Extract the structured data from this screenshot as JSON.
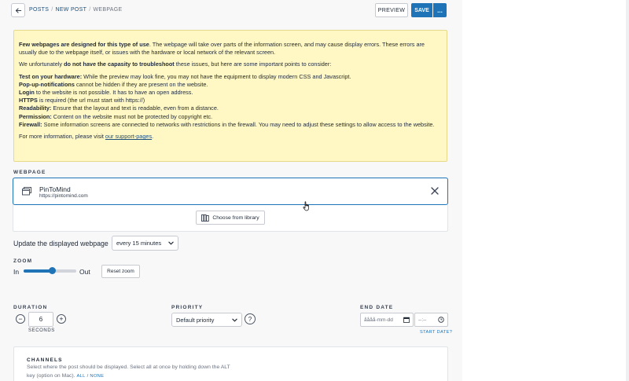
{
  "colors": {
    "accent": "#1f73b7",
    "notice_bg": "#fff8c5",
    "notice_border": "#e6da8a",
    "link": "#1f4e79"
  },
  "header": {
    "back_icon": "arrow-left-icon",
    "breadcrumb": {
      "item1": "POSTS",
      "sep1": "/",
      "item2": "NEW POST",
      "sep2": "/",
      "current": "WEBPAGE"
    },
    "preview_label": "PREVIEW",
    "save_label": "SAVE",
    "more_label": "..."
  },
  "notice": {
    "line1_bold": "Few webpages are designed for this type of use",
    "line1_rest": ". The webpage will take over parts of the information screen, and may cause display errors. These errors are usually due to the webpage itself, or issues with the hardware or local network of the relevant screen.",
    "line2_pre": "We unfortunately ",
    "line2_bold": "do not have the capasity to troubleshoot",
    "line2_post": " these issues, but here are some important points to consider:",
    "items": [
      {
        "bold": "Test on your hardware:",
        "text": " While the preview may look fine, you may not have the equipment to display modern CSS and Javascript."
      },
      {
        "bold": "Pop-up-notifications",
        "text": " cannot be hidden if they are present on the website."
      },
      {
        "bold": "Login",
        "text": " to the website is not possible. It has to have an open address."
      },
      {
        "bold": "HTTPS",
        "text": " is required (the url must start with https://)"
      },
      {
        "bold": "Readability:",
        "text": " Ensure that the layout and text is readable, even from a distance."
      },
      {
        "bold": "Permission:",
        "text": " Content on the website must not be protected by copyright etc."
      },
      {
        "bold": "Firewall:",
        "text": " Some information screens are connected to networks with restrictions in the firewall. You may need to adjust these settings to allow access to the website."
      }
    ],
    "more_info_pre": "For more information, please visit ",
    "more_info_link": "our support-pages",
    "more_info_post": "."
  },
  "webpage": {
    "section_label": "WEBPAGE",
    "name": "PinToMind",
    "url": "https://pintomind.com",
    "icon": "browser-window-icon",
    "close_icon": "close-icon",
    "library_icon": "library-icon",
    "library_label": "Choose from library"
  },
  "update": {
    "label": "Update the displayed webpage",
    "selected": "every 15 minutes"
  },
  "zoom": {
    "section_label": "ZOOM",
    "in_label": "In",
    "out_label": "Out",
    "level_fraction": 0.55,
    "reset_label": "Reset zoom"
  },
  "duration": {
    "section_label": "DURATION",
    "value": "6",
    "minus_label": "−",
    "plus_label": "+",
    "unit_label": "SECONDS"
  },
  "priority": {
    "section_label": "PRIORITY",
    "selected": "Default priority",
    "help_label": "?"
  },
  "end_date": {
    "section_label": "END DATE",
    "date_placeholder": "åååå-mm-dd",
    "time_placeholder": "--:--",
    "start_date_link": "START DATE?"
  },
  "channels": {
    "title": "CHANNELS",
    "desc": "Select where the post should be displayed. Select all at once by holding down the ALT key (option on Mac).",
    "all_label": "ALL",
    "sep": "/",
    "none_label": "NONE"
  }
}
